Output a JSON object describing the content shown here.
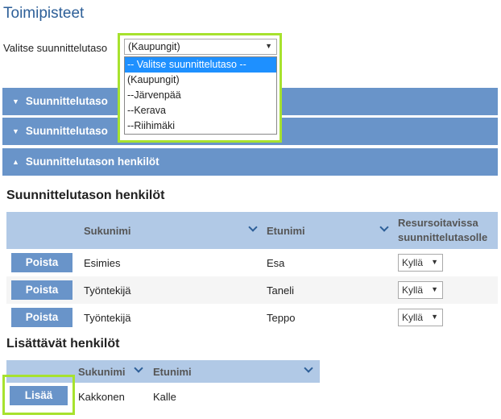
{
  "page": {
    "title": "Toimipisteet"
  },
  "level_select": {
    "label": "Valitse suunnittelutaso",
    "value": "(Kaupungit)",
    "options": [
      {
        "label": "-- Valitse suunnittelutaso --",
        "selected": true
      },
      {
        "label": "(Kaupungit)"
      },
      {
        "label": "--Järvenpää"
      },
      {
        "label": "--Kerava"
      },
      {
        "label": "--Riihimäki"
      }
    ]
  },
  "accordions": [
    {
      "label": "Suunnittelutaso",
      "state": "collapsed"
    },
    {
      "label": "Suunnittelutaso",
      "state": "collapsed"
    },
    {
      "label": "Suunnittelutason henkilöt",
      "state": "expanded"
    }
  ],
  "persons": {
    "title": "Suunnittelutason henkilöt",
    "columns": [
      "Sukunimi",
      "Etunimi",
      "Resursoitavissa suunnittelutasolle"
    ],
    "column_3_lines": [
      "Resursoitavissa",
      "suunnittelutasolle"
    ],
    "rows": [
      {
        "action": "Poista",
        "last": "Esimies",
        "first": "Esa",
        "resource": "Kyllä"
      },
      {
        "action": "Poista",
        "last": "Työntekijä",
        "first": "Taneli",
        "resource": "Kyllä"
      },
      {
        "action": "Poista",
        "last": "Työntekijä",
        "first": "Teppo",
        "resource": "Kyllä"
      }
    ]
  },
  "additions": {
    "title": "Lisättävät henkilöt",
    "columns": [
      "Sukunimi",
      "Etunimi"
    ],
    "rows": [
      {
        "action": "Lisää",
        "last": "Kakkonen",
        "first": "Kalle"
      }
    ]
  },
  "colors": {
    "accent": "#6994c9",
    "header": "#b1c9e6",
    "highlight": "#a7e22e",
    "title": "#2d5f98"
  }
}
